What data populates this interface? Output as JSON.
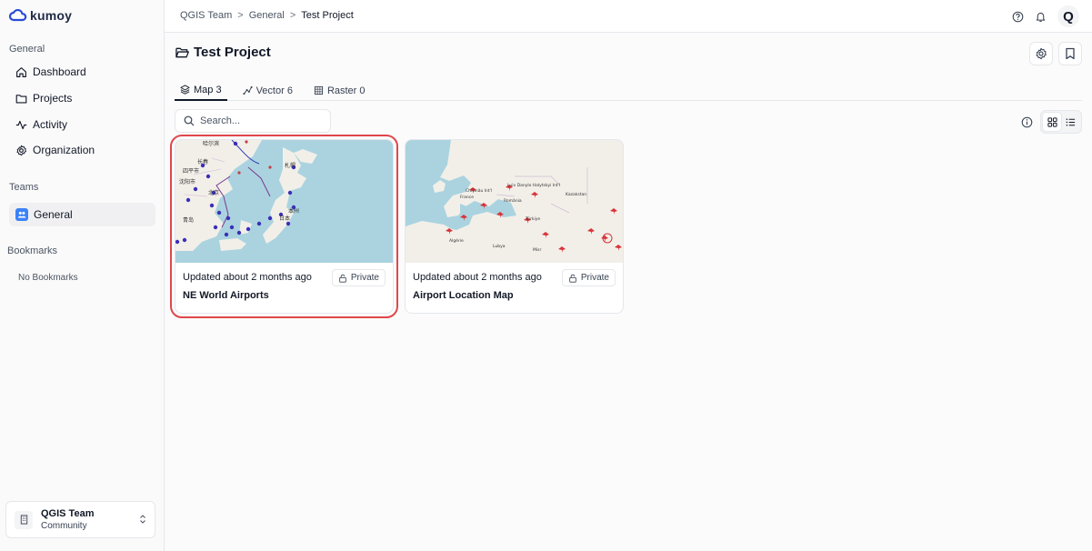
{
  "brand": {
    "name": "kumoy"
  },
  "sidebar": {
    "general_label": "General",
    "nav": [
      {
        "label": "Dashboard",
        "icon": "home-icon"
      },
      {
        "label": "Projects",
        "icon": "folder-icon"
      },
      {
        "label": "Activity",
        "icon": "activity-icon"
      },
      {
        "label": "Organization",
        "icon": "gear-icon"
      }
    ],
    "teams_label": "Teams",
    "teams": [
      {
        "label": "General",
        "icon": "team-icon"
      }
    ],
    "bookmarks_label": "Bookmarks",
    "no_bookmarks": "No Bookmarks",
    "team_switcher": {
      "name": "QGIS Team",
      "plan": "Community"
    }
  },
  "breadcrumb": {
    "items": [
      "QGIS Team",
      "General"
    ],
    "current": "Test Project",
    "separator": ">"
  },
  "header": {
    "avatar_letter": "Q"
  },
  "page": {
    "title": "Test Project",
    "tabs": [
      {
        "label": "Map 3",
        "icon": "layers-icon",
        "active": true
      },
      {
        "label": "Vector 6",
        "icon": "vector-icon",
        "active": false
      },
      {
        "label": "Raster 0",
        "icon": "raster-icon",
        "active": false
      }
    ],
    "search_placeholder": "Search...",
    "view_mode": "grid"
  },
  "maps": [
    {
      "title": "NE World Airports",
      "updated": "Updated about 2 months ago",
      "visibility": "Private",
      "highlighted": true,
      "thumb_labels": [
        "哈尔滨",
        "长春",
        "四平市",
        "沈阳市",
        "北京",
        "青岛",
        "札幌",
        "日本",
        "本州"
      ]
    },
    {
      "title": "Airport Location Map",
      "updated": "Updated about 2 months ago",
      "visibility": "Private",
      "highlighted": false,
      "thumb_labels": [
        "Luiv Danylo Halytskyi Int'l",
        "Chišinău Int'l",
        "Kazakstan",
        "France",
        "România",
        "Türkiye",
        "Algérie",
        "Lubya",
        "Misr"
      ]
    }
  ],
  "colors": {
    "accent": "#3b82f6",
    "highlight": "#e0474c",
    "water": "#aad3df",
    "land": "#f2efe9"
  }
}
